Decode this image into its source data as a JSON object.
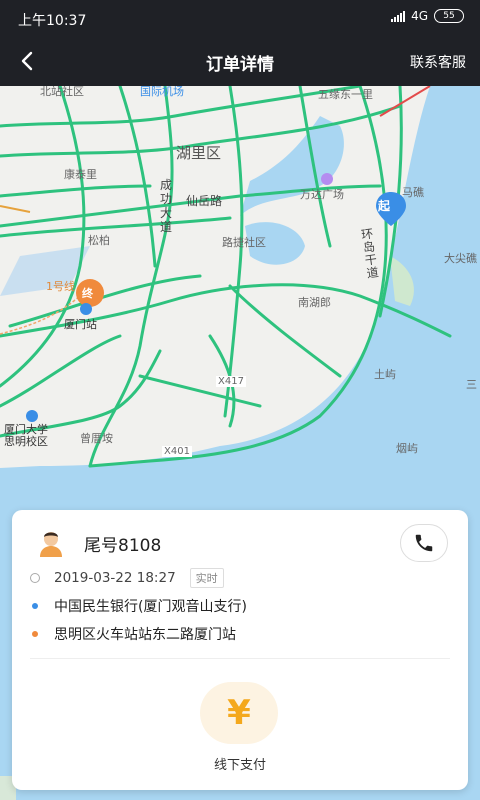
{
  "status_bar": {
    "time": "上午10:37",
    "network": "4G",
    "battery": "55"
  },
  "header": {
    "title": "订单详情",
    "service": "联系客服"
  },
  "map": {
    "labels": {
      "huli": "湖里区",
      "xianyue": "仙岳路",
      "wanda": "万达广场",
      "chenggong": "成功大道",
      "kangtai": "康泰里",
      "songbai": "松柏",
      "jiangjie": "路捷社区",
      "huandao": "环岛干道",
      "nanhu": "南湖郎",
      "xiamen_station": "厦门站",
      "yihao": "1号线",
      "x417": "X417",
      "x401": "X401",
      "zengcuoan": "曾厝垵",
      "xiada": "厦门大学\n思明校区",
      "tuyu": "土屿",
      "yanyu": "烟屿",
      "dajian": "大尖礁",
      "sanm": "三",
      "mabi": "马礁",
      "beizhan": "北站社区",
      "guoji": "国际机场",
      "wushi": "五缘东一里"
    },
    "markers": {
      "start": "起",
      "end": "终"
    }
  },
  "order": {
    "plate": "尾号8108",
    "datetime": "2019-03-22 18:27",
    "type_tag": "实时",
    "start": "中国民生银行(厦门观音山支行)",
    "end": "思明区火车站站东二路厦门站",
    "pay_label": "线下支付",
    "pay_symbol": "¥"
  },
  "colors": {
    "header_bg": "#1f2126",
    "road_green": "#2ec27e",
    "start_blue": "#3a8ee6",
    "end_orange": "#f08a3c",
    "pay_yellow": "#f4a81c"
  }
}
